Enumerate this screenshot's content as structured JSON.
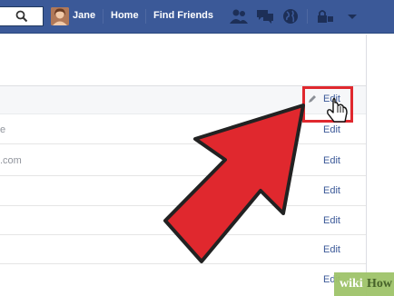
{
  "topbar": {
    "user_name": "Jane",
    "home_label": "Home",
    "find_friends_label": "Find Friends"
  },
  "rows": [
    {
      "text": "e",
      "edit": "Edit"
    },
    {
      "text": ".com",
      "edit": "Edit"
    },
    {
      "text": "",
      "edit": "Edit"
    },
    {
      "text": "",
      "edit": "Edit"
    },
    {
      "text": "",
      "edit": "Edit"
    },
    {
      "text": "",
      "edit": "Edit"
    }
  ],
  "highlighted_row": {
    "edit": "Edit"
  },
  "watermark": {
    "wiki": "wiki",
    "how": "How"
  },
  "colors": {
    "topbar": "#3b5998",
    "link": "#3b5998",
    "arrow": "#e0282e",
    "highlight_box": "#e0282e"
  },
  "icons": [
    "search-icon",
    "friend-requests-icon",
    "messages-icon",
    "notifications-globe-icon",
    "privacy-lock-icon",
    "pencil-icon",
    "pointer-hand-icon"
  ]
}
